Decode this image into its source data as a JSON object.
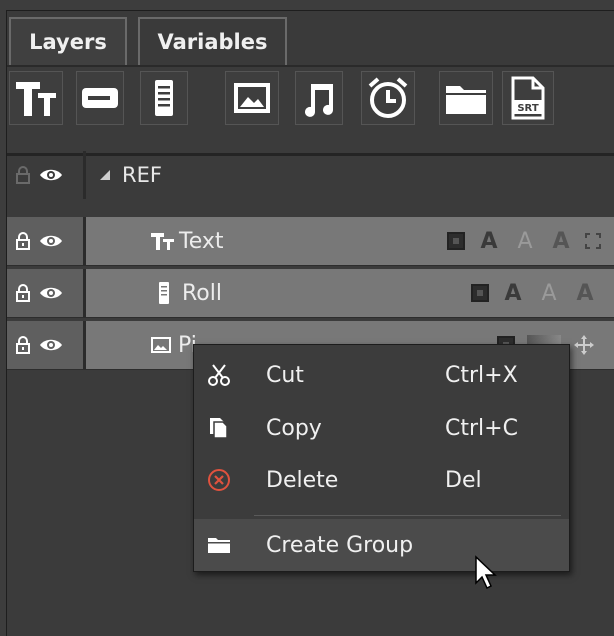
{
  "tabs": [
    {
      "label": "Layers",
      "active": true
    },
    {
      "label": "Variables",
      "active": false
    }
  ],
  "toolbar": {
    "buttons": [
      {
        "icon": "text-layer-icon"
      },
      {
        "icon": "ticker-layer-icon"
      },
      {
        "icon": "roll-layer-icon"
      },
      {
        "icon": "image-layer-icon"
      },
      {
        "icon": "audio-layer-icon"
      },
      {
        "icon": "clock-layer-icon"
      },
      {
        "icon": "folder-layer-icon"
      },
      {
        "icon": "srt-layer-icon",
        "label": "SRT"
      }
    ]
  },
  "layers": {
    "group": {
      "name": "REF",
      "expanded": true
    },
    "items": [
      {
        "name": "Text",
        "icon": "text-layer-icon"
      },
      {
        "name": "Roll",
        "icon": "roll-layer-icon"
      },
      {
        "name": "Pi",
        "icon": "image-layer-icon"
      }
    ]
  },
  "context_menu": {
    "items": [
      {
        "label": "Cut",
        "shortcut": "Ctrl+X",
        "icon": "scissors-icon"
      },
      {
        "label": "Copy",
        "shortcut": "Ctrl+C",
        "icon": "copy-icon"
      },
      {
        "label": "Delete",
        "shortcut": "Del",
        "icon": "delete-icon"
      },
      {
        "label": "Create Group",
        "shortcut": "",
        "icon": "folder-icon",
        "highlighted": true
      }
    ]
  },
  "colors": {
    "background": "#3b3b3b",
    "layer_row": "#787878",
    "delete_icon": "#e0523e"
  }
}
